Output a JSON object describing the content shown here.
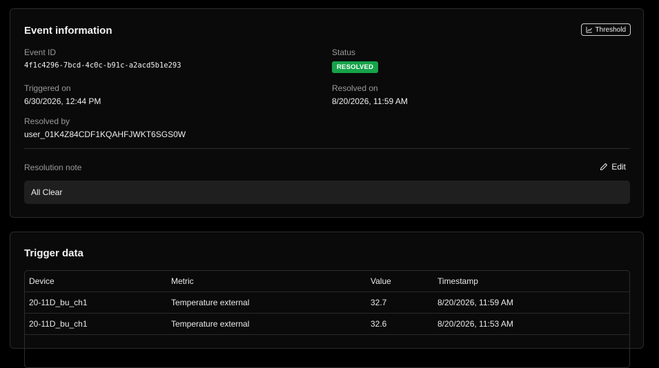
{
  "event_info": {
    "title": "Event information",
    "threshold_label": "Threshold",
    "event_id": {
      "label": "Event ID",
      "value": "4f1c4296-7bcd-4c0c-b91c-a2acd5b1e293"
    },
    "status": {
      "label": "Status",
      "value": "RESOLVED",
      "color": "#16a34a"
    },
    "triggered_on": {
      "label": "Triggered on",
      "value": "6/30/2026, 12:44 PM"
    },
    "resolved_on": {
      "label": "Resolved on",
      "value": "8/20/2026, 11:59 AM"
    },
    "resolved_by": {
      "label": "Resolved by",
      "value": "user_01K4Z84CDF1KQAHFJWKT6SGS0W"
    },
    "resolution_note": {
      "label": "Resolution note",
      "edit_label": "Edit",
      "value": "All Clear"
    }
  },
  "trigger_data": {
    "title": "Trigger data",
    "columns": [
      "Device",
      "Metric",
      "Value",
      "Timestamp"
    ],
    "rows": [
      [
        "20-11D_bu_ch1",
        "Temperature external",
        "32.7",
        "8/20/2026, 11:59 AM"
      ],
      [
        "20-11D_bu_ch1",
        "Temperature external",
        "32.6",
        "8/20/2026, 11:53 AM"
      ]
    ]
  }
}
